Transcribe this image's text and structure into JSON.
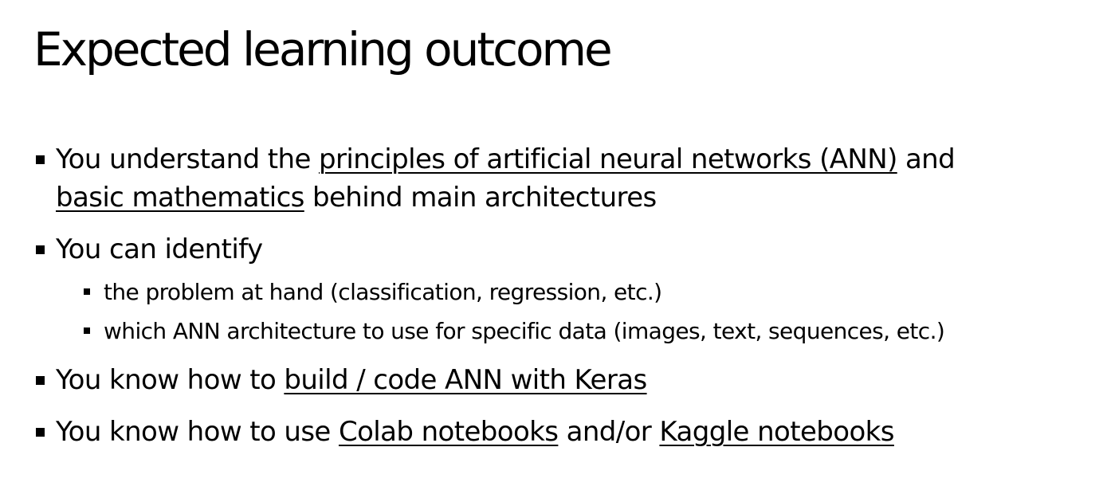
{
  "title": "Expected learning outcome",
  "bullets": {
    "b1": {
      "t1": "You understand the ",
      "link1": "principles of artificial neural networks (ANN)",
      "t2": " and",
      "link2": "basic mathematics",
      "t3": " behind main architectures"
    },
    "b2": {
      "text": "You can identify",
      "sub1": "the problem at hand (classification, regression, etc.)",
      "sub2": "which ANN architecture to use for specific data (images, text, sequences, etc.)"
    },
    "b3": {
      "t1": "You know how to ",
      "link1": "build / code ANN with Keras"
    },
    "b4": {
      "t1": "You know how to use ",
      "link1": "Colab notebooks",
      "t2": " and/or ",
      "link2": "Kaggle notebooks"
    }
  }
}
